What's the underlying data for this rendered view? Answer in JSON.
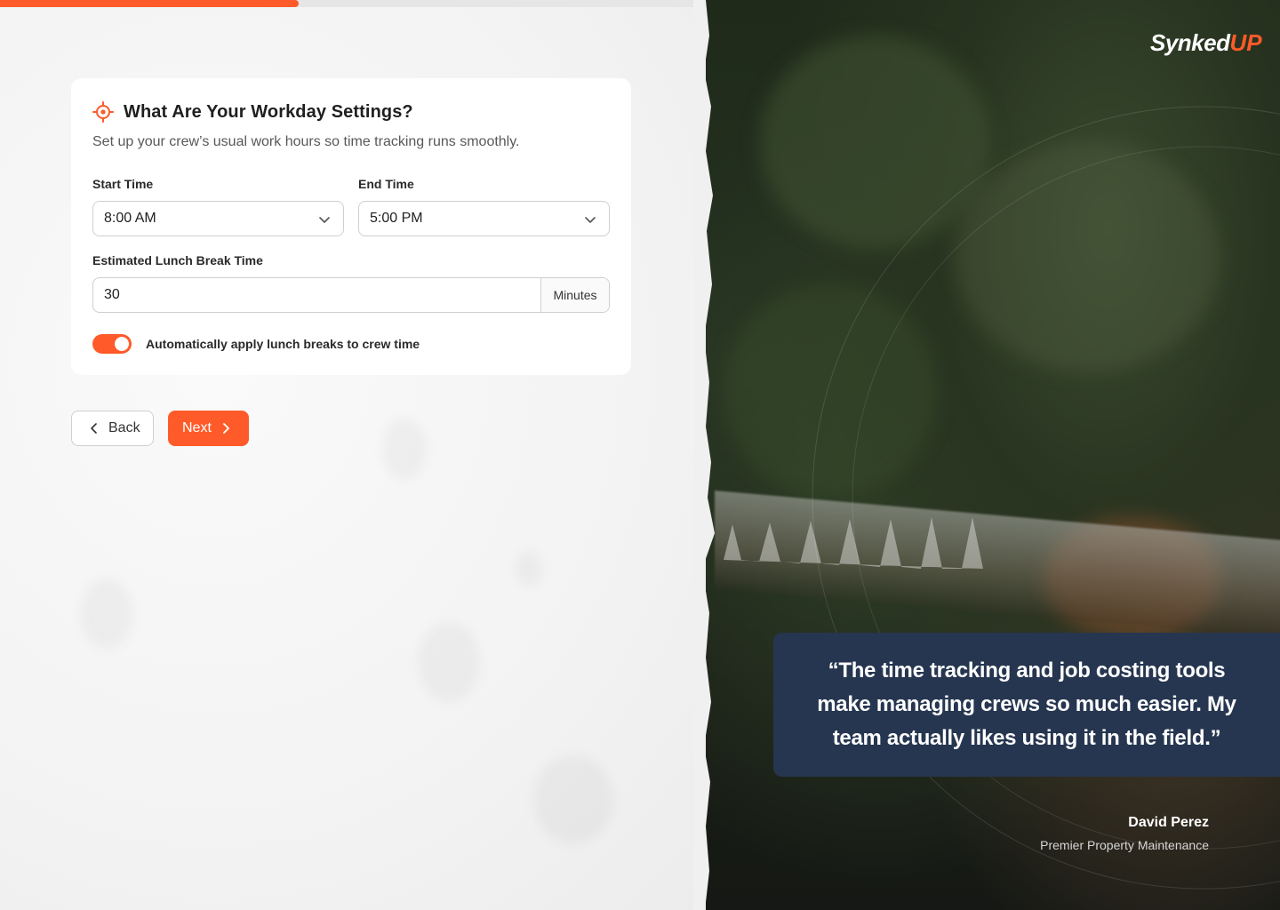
{
  "progress": {
    "fraction": 0.233
  },
  "workday": {
    "title": "What Are Your Workday Settings?",
    "subtitle": "Set up your crew’s usual work hours so time tracking runs smoothly.",
    "start_time": {
      "label": "Start Time",
      "value": "8:00 AM"
    },
    "end_time": {
      "label": "End Time",
      "value": "5:00 PM"
    },
    "lunch_break": {
      "label": "Estimated Lunch Break Time",
      "value": "30",
      "unit": "Minutes"
    },
    "auto_apply": {
      "label": "Automatically apply lunch breaks to crew time",
      "enabled": true
    }
  },
  "nav": {
    "back_label": "Back",
    "next_label": "Next"
  },
  "brand": {
    "logo_main": "Synked",
    "logo_accent": "UP",
    "accent_color": "#ff5a29",
    "quote_bg": "#263650"
  },
  "testimonial": {
    "quote": "“The time tracking and job costing tools make managing crews so much easier. My team actually likes using it in the field.”",
    "author": "David Perez",
    "company": "Premier Property Maintenance"
  },
  "icons": {
    "title_icon": "target-icon",
    "select_icon": "chevron-down-icon",
    "back_icon": "chevron-left-icon",
    "next_icon": "chevron-right-icon"
  }
}
